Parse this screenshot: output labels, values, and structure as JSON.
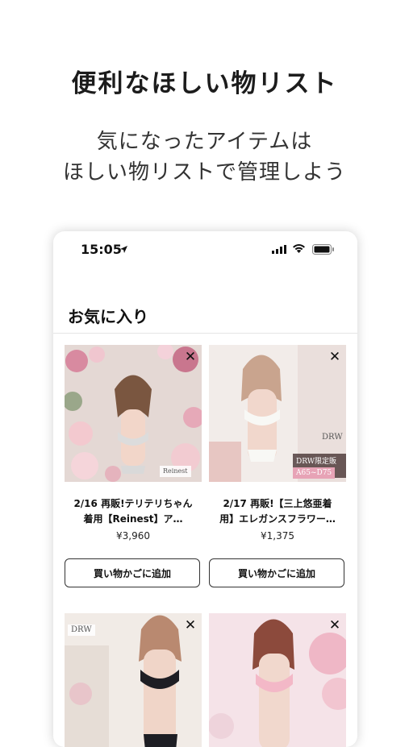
{
  "promo": {
    "headline": "便利なほしい物リスト",
    "subline1": "気になったアイテムは",
    "subline2": "ほしい物リストで管理しよう"
  },
  "status_bar": {
    "time": "15:05"
  },
  "favorites": {
    "title": "お気に入り",
    "items": [
      {
        "title_line1": "2/16 再販!テリテリちゃん",
        "title_line2": "着用【Reinest】ア…",
        "price": "¥3,960",
        "cart_label": "買い物かごに追加",
        "close": "✕",
        "image_text": "Reinest"
      },
      {
        "title_line1": "2/17 再販!【三上悠亜着",
        "title_line2": "用】エレガンスフラワー…",
        "price": "¥1,375",
        "cart_label": "買い物かごに追加",
        "close": "✕",
        "image_badge_top": "DRW限定販売",
        "image_badge_bottom": "A65~D75",
        "image_brand": "DRW"
      },
      {
        "close": "✕",
        "image_brand": "DRW"
      },
      {
        "close": "✕"
      }
    ]
  },
  "colors": {
    "accent_pink": "#e7a3b6",
    "text_dark": "#1c1c1c",
    "button_border": "#333333"
  }
}
